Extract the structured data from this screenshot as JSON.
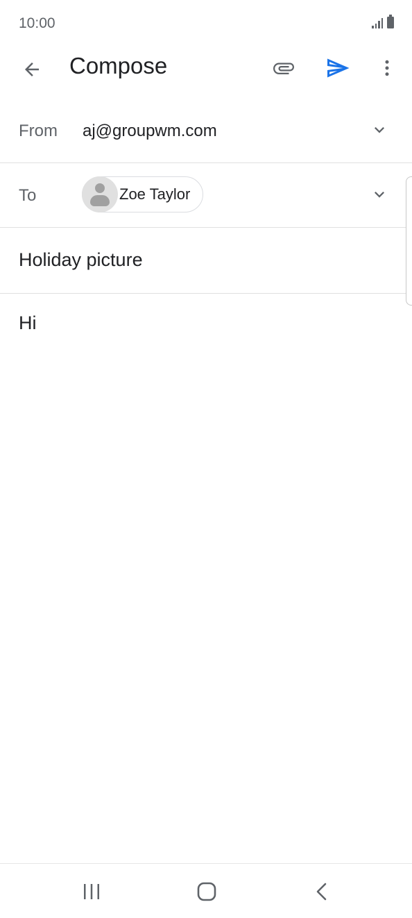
{
  "status_bar": {
    "time": "10:00"
  },
  "app_bar": {
    "title": "Compose",
    "icons": [
      "back-arrow-icon",
      "attachment-icon",
      "send-icon",
      "more-vert-icon"
    ],
    "send_color": "#1a73e8"
  },
  "from": {
    "label": "From",
    "value": "aj@groupwm.com"
  },
  "to": {
    "label": "To",
    "recipients": [
      {
        "name": "Zoe Taylor"
      }
    ]
  },
  "subject": {
    "value": "Holiday picture"
  },
  "body": {
    "value": "Hi"
  },
  "nav_bar": {
    "icons": [
      "recents-icon",
      "home-icon",
      "nav-back-icon"
    ]
  }
}
